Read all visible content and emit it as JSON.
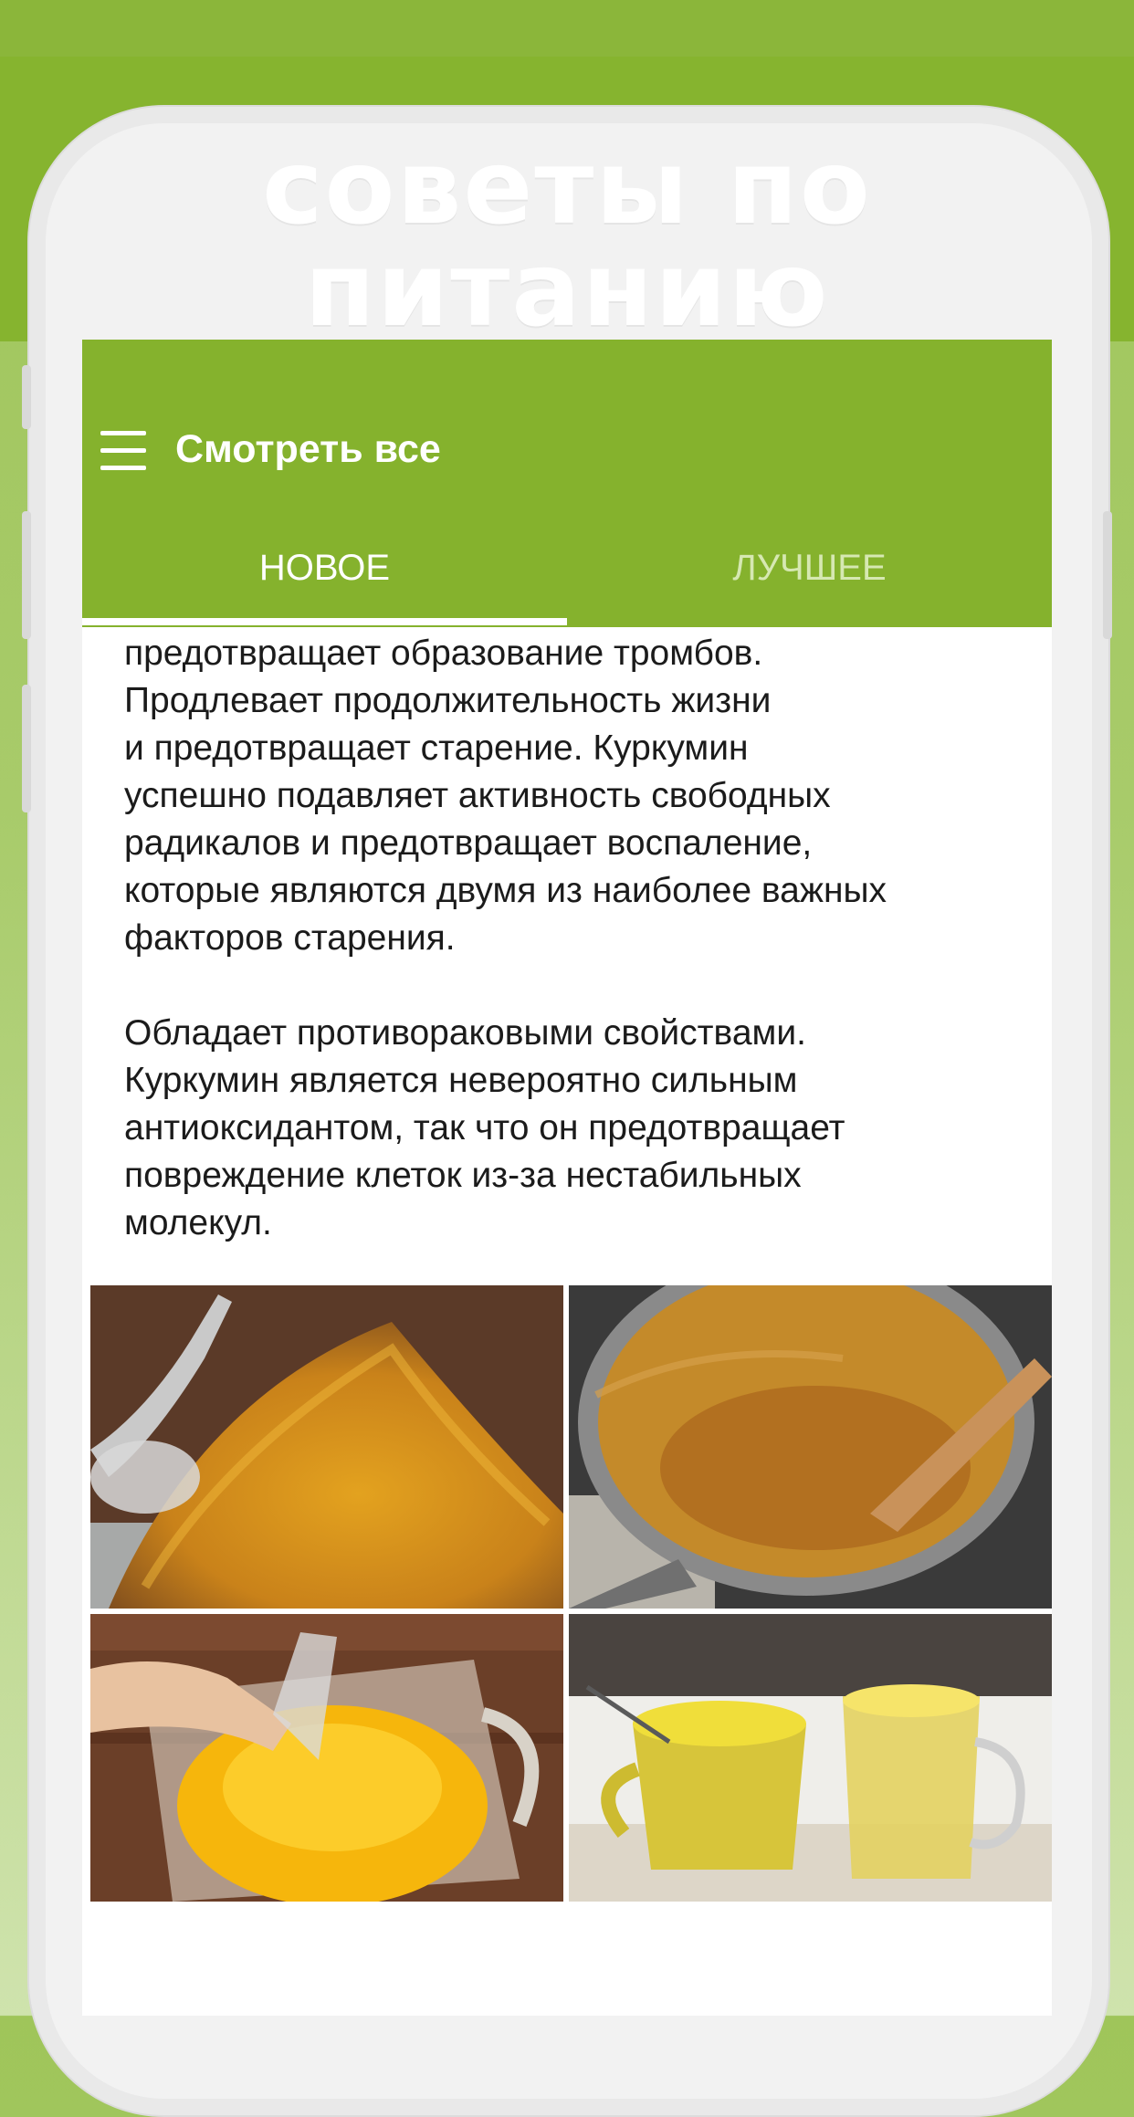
{
  "banner": {
    "headline": "советы по питанию"
  },
  "appbar": {
    "title": "Смотреть все",
    "menu_icon": "hamburger-menu-icon"
  },
  "tabs": [
    {
      "label": "НОВОЕ",
      "selected": true
    },
    {
      "label": "ЛУЧШЕЕ",
      "selected": false
    }
  ],
  "article": {
    "paragraphs": [
      "предотвращает образование тромбов.\nПродлевает продолжительность жизни\nи предотвращает старение. Куркумин\nуспешно подавляет активность свободных\nрадикалов и предотвращает воспаление,\nкоторые являются двумя из наиболее важных\nфакторов старения.",
      "Обладает противораковыми свойствами.\nКуркумин является невероятно сильным\nантиоксидантом, так что он предотвращает\nповреждение клеток из-за нестабильных\nмолекул."
    ]
  },
  "colors": {
    "accent": "#85b22d",
    "banner": "#86b42f",
    "tab_inactive": "#d6e8b2",
    "text": "#1b1b1b"
  }
}
